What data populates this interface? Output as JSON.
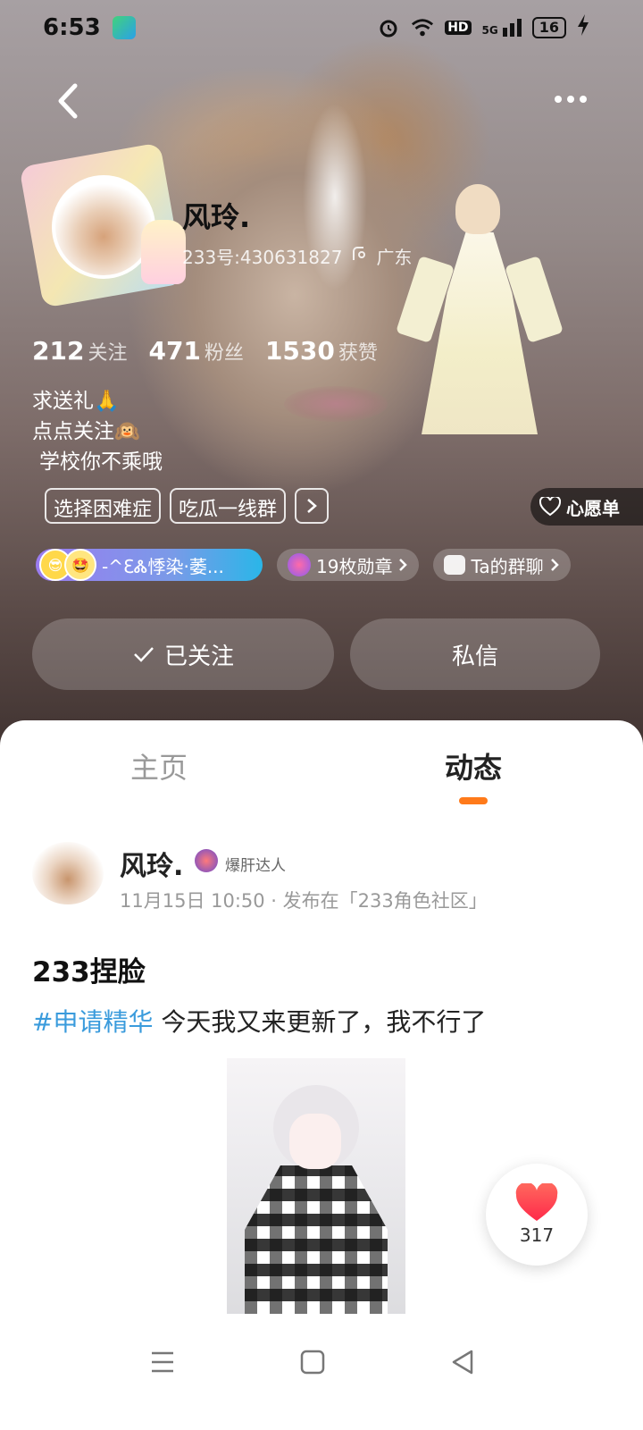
{
  "status_bar": {
    "time": "6:53",
    "network": "5G",
    "hd": "HD",
    "battery": "16"
  },
  "profile": {
    "name": "风玲.",
    "uid": "233号:430631827",
    "location": "广东",
    "stats": [
      {
        "value": "212",
        "label": "关注"
      },
      {
        "value": "471",
        "label": "粉丝"
      },
      {
        "value": "1530",
        "label": "获赞"
      }
    ],
    "bio": [
      "求送礼🙏",
      "点点关注🙉",
      "学校你不乘哦"
    ],
    "tags": [
      "选择困难症",
      "吃瓜一线群"
    ],
    "wishlist_label": "心愿单",
    "group_label": "-^ƐᏜ悸染·萎...",
    "medals_label": "19枚勋章",
    "chat_group_label": "Ta的群聊",
    "follow_label": "已关注",
    "message_label": "私信"
  },
  "tabs": {
    "home": "主页",
    "feed": "动态"
  },
  "post": {
    "author": "风玲.",
    "badge": "爆肝达人",
    "meta": "11月15日 10:50 · 发布在「233角色社区」",
    "title": "233捏脸",
    "hashtag": "#申请精华",
    "body": " 今天我又来更新了，我不行了",
    "likes": "317"
  },
  "colors": {
    "accent": "#ff7a1a",
    "hashtag": "#3a9bdc",
    "like": "#ff3b4e"
  }
}
